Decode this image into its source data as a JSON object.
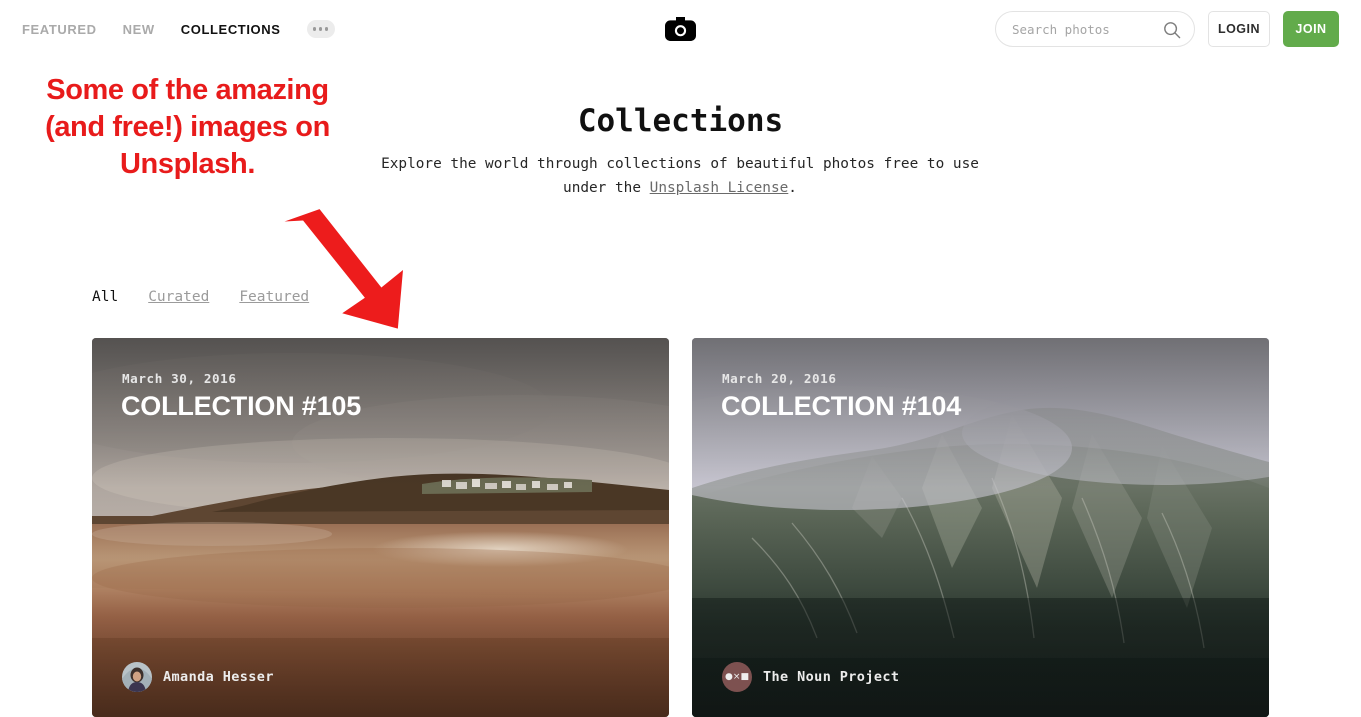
{
  "header": {
    "nav_items": [
      {
        "label": "FEATURED",
        "active": false
      },
      {
        "label": "NEW",
        "active": false
      },
      {
        "label": "COLLECTIONS",
        "active": true
      }
    ],
    "more_button_label": "•••",
    "logo_icon": "camera-icon",
    "search": {
      "placeholder": "Search photos",
      "value": "",
      "icon": "search-icon"
    },
    "login_label": "LOGIN",
    "join_label": "JOIN",
    "join_color": "#62ab4b"
  },
  "page": {
    "title": "Collections",
    "subtitle_before": "Explore the world through collections of beautiful photos free to use under the ",
    "subtitle_link": "Unsplash License",
    "subtitle_after": "."
  },
  "annotation": {
    "text": "Some of the amazing (and free!) images on Unsplash.",
    "color": "#e81b1b",
    "arrow_icon": "down-right-arrow-icon"
  },
  "filters": [
    {
      "label": "All",
      "active": true
    },
    {
      "label": "Curated",
      "active": false
    },
    {
      "label": "Featured",
      "active": false
    }
  ],
  "collections": [
    {
      "date": "March 30, 2016",
      "title": "COLLECTION #105",
      "author": "Amanda Hesser",
      "avatar_type": "photo",
      "photo_description": "coastal-headland-beach-reflection"
    },
    {
      "date": "March 20, 2016",
      "title": "COLLECTION #104",
      "author": "The Noun Project",
      "avatar_type": "glyphs",
      "avatar_glyphs": "●×■",
      "photo_description": "misty-mountain-ridge-fog"
    }
  ]
}
